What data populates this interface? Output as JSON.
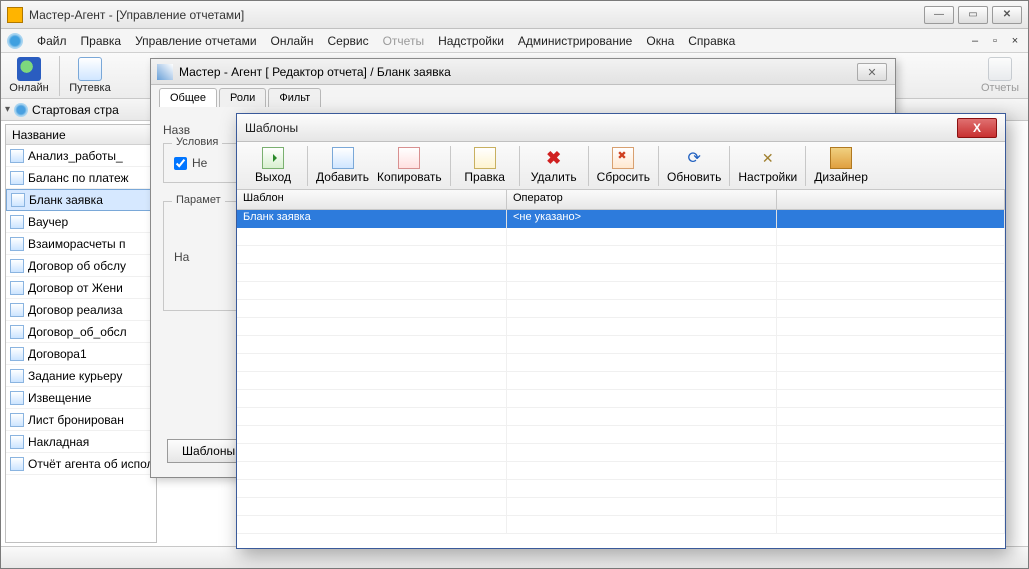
{
  "main": {
    "title": "Мастер-Агент - [Управление отчетами]",
    "menu": [
      "Файл",
      "Правка",
      "Управление отчетами",
      "Онлайн",
      "Сервис",
      "Отчеты",
      "Надстройки",
      "Администрирование",
      "Окна",
      "Справка"
    ],
    "menu_disabled_index": 5,
    "toolbar": [
      {
        "label": "Онлайн",
        "icon": "globe"
      },
      {
        "label": "Путевка",
        "icon": "doc"
      }
    ],
    "toolbar_right": {
      "label": "Отчеты",
      "icon": "doc",
      "disabled": true
    },
    "startbar": "Стартовая стра"
  },
  "sidebar": {
    "header": "Название",
    "items": [
      "Анализ_работы_",
      "Баланс по платеж",
      "Бланк заявка",
      "Ваучер",
      "Взаиморасчеты п",
      "Договор об обслу",
      "Договор от Жени",
      "Договор реализа",
      "Договор_об_обсл",
      "Договора1",
      "Задание курьеру",
      "Извещение",
      "Лист бронирован",
      "Накладная",
      "Отчёт агента об исполнении по"
    ],
    "selected_index": 2
  },
  "editor": {
    "title": "Мастер - Агент [ Редактор отчета] / Бланк заявка",
    "tabs": [
      "Общее",
      "Роли",
      "Фильт"
    ],
    "active_tab": 0,
    "label_name": "Назв",
    "group_conditions": "Условия",
    "checkbox_ne": "Не",
    "group_params": "Парамет",
    "label_na": "На",
    "button_templates": "Шаблоны"
  },
  "dialog": {
    "title": "Шаблоны",
    "toolbar": [
      {
        "label": "Выход",
        "icon": "exit"
      },
      {
        "label": "Добавить",
        "icon": "add"
      },
      {
        "label": "Копировать",
        "icon": "copy"
      },
      {
        "label": "Правка",
        "icon": "edit"
      },
      {
        "label": "Удалить",
        "icon": "del"
      },
      {
        "label": "Сбросить",
        "icon": "reset"
      },
      {
        "label": "Обновить",
        "icon": "refresh"
      },
      {
        "label": "Настройки",
        "icon": "settings"
      },
      {
        "label": "Дизайнер",
        "icon": "designer"
      }
    ],
    "columns": [
      "Шаблон",
      "Оператор",
      ""
    ],
    "rows": [
      {
        "template": "Бланк заявка",
        "operator": "<не указано>"
      }
    ]
  }
}
